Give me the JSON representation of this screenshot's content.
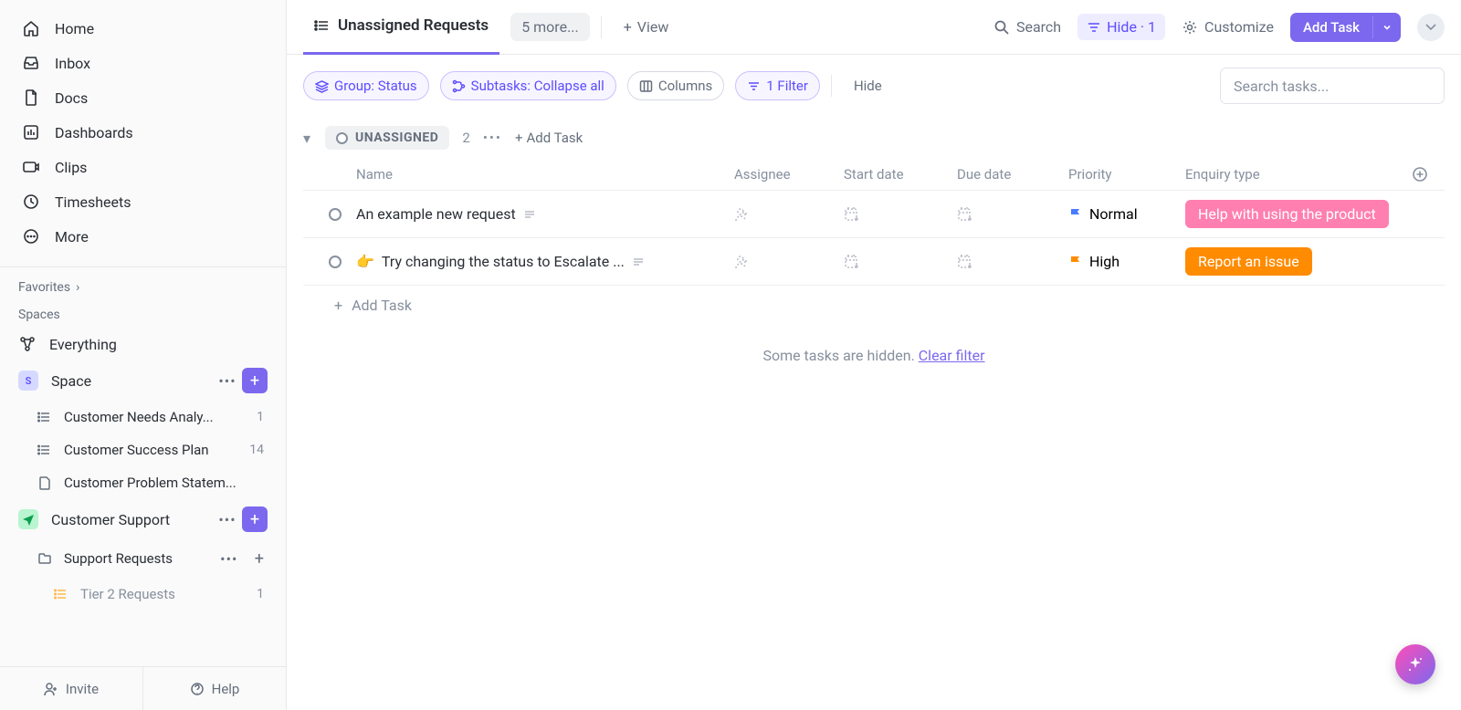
{
  "sidebar": {
    "nav": [
      {
        "label": "Home"
      },
      {
        "label": "Inbox"
      },
      {
        "label": "Docs"
      },
      {
        "label": "Dashboards"
      },
      {
        "label": "Clips"
      },
      {
        "label": "Timesheets"
      },
      {
        "label": "More"
      }
    ],
    "favorites_label": "Favorites",
    "spaces_label": "Spaces",
    "everything_label": "Everything",
    "space1": {
      "badge": "S",
      "name": "Space"
    },
    "space1_lists": [
      {
        "name": "Customer Needs Analy...",
        "count": "1"
      },
      {
        "name": "Customer Success Plan",
        "count": "14"
      },
      {
        "name": "Customer Problem Statem..."
      }
    ],
    "space2": {
      "name": "Customer Support"
    },
    "space2_lists": [
      {
        "name": "Support Requests"
      },
      {
        "name": "Tier 2 Requests",
        "count": "1"
      }
    ],
    "invite_label": "Invite",
    "help_label": "Help"
  },
  "topbar": {
    "view_name": "Unassigned Requests",
    "more_tabs": "5 more...",
    "add_view": "View",
    "search": "Search",
    "hide": "Hide · 1",
    "customize": "Customize",
    "add_task": "Add Task"
  },
  "filters": {
    "group": "Group: Status",
    "subtasks": "Subtasks: Collapse all",
    "columns": "Columns",
    "filter": "1 Filter",
    "hide": "Hide",
    "search_placeholder": "Search tasks..."
  },
  "group": {
    "status": "UNASSIGNED",
    "count": "2",
    "add": "Add Task"
  },
  "columns": {
    "name": "Name",
    "assignee": "Assignee",
    "start": "Start date",
    "due": "Due date",
    "priority": "Priority",
    "enquiry": "Enquiry type"
  },
  "rows": [
    {
      "name": "An example new request",
      "priority": "Normal",
      "priority_color": "blue",
      "enquiry": "Help with using the product",
      "enquiry_class": "tag-pink",
      "emoji": ""
    },
    {
      "name": "Try changing the status to Escalate ...",
      "priority": "High",
      "priority_color": "orange",
      "enquiry": "Report an issue",
      "enquiry_class": "tag-orange",
      "emoji": "👉 "
    }
  ],
  "add_row": "Add Task",
  "hidden": {
    "msg": "Some tasks are hidden. ",
    "link": "Clear filter"
  }
}
